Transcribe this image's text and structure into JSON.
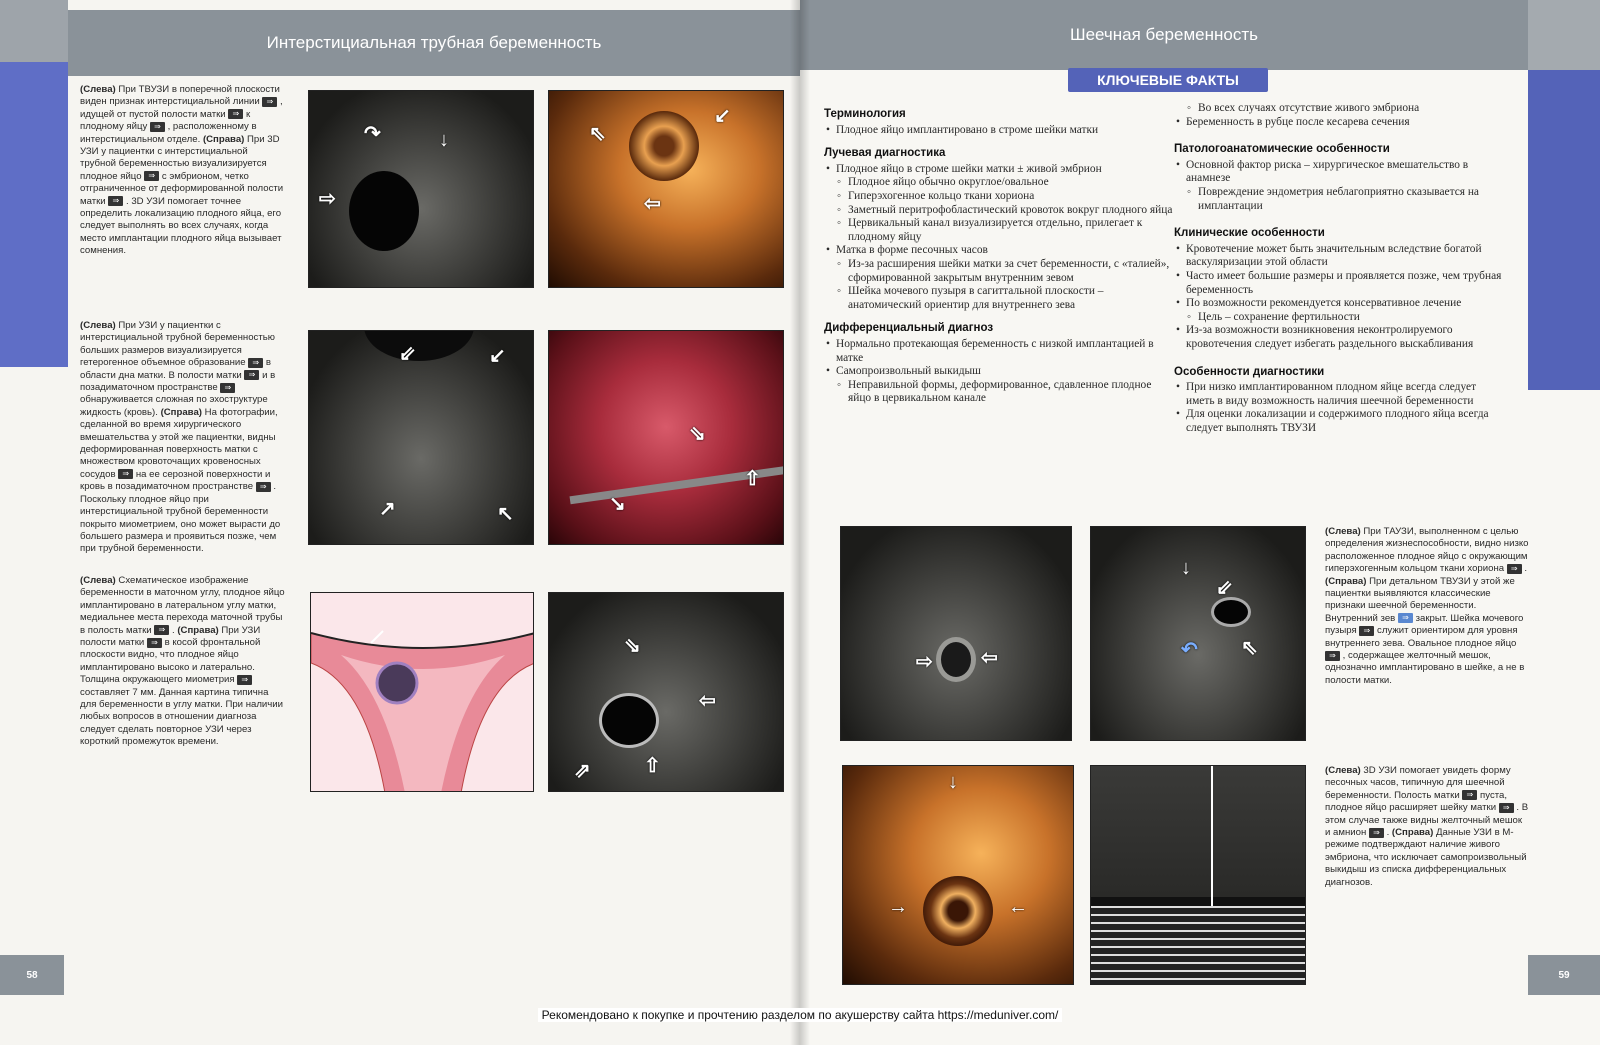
{
  "left_page": {
    "title": "Интерстициальная трубная беременность",
    "page_number": "58",
    "captions": [
      {
        "segments": [
          "(Слева)",
          " При ТВУЗИ в поперечной плоскости виден признак интерстициальной линии ",
          " , идущей от пустой полости матки ",
          " к плодному яйцу ",
          " , расположенному в интерстициальном отделе. ",
          "(Справа)",
          " При 3D УЗИ у пациентки с интерстициальной трубной беременностью визуализируется плодное яйцо ",
          " с эмбрионом, четко отграниченное от деформированной полости матки ",
          " . 3D УЗИ помогает точнее определить локализацию плодного яйца, его следует выполнять во всех случаях, когда место имплантации плодного яйца вызывает сомнения."
        ]
      },
      {
        "segments": [
          "(Слева)",
          " При УЗИ у пациентки с интерстициальной трубной беременностью больших размеров визуализируется гетерогенное объемное образование ",
          " в области дна матки. В полости матки ",
          " и в позадиматочном пространстве ",
          " обнаруживается сложная по эхоструктуре жидкость (кровь). ",
          "(Справа)",
          " На фотографии, сделанной во время хирургического вмешательства у этой же пациентки, видны деформированная поверхность матки с множеством кровоточащих кровеносных сосудов ",
          " на ее серозной поверхности и кровь в позадиматочном пространстве ",
          " . Поскольку плодное яйцо при интерстициальной трубной беременности покрыто миометрием, оно может вырасти до большего размера и проявиться позже, чем при трубной беременности."
        ]
      },
      {
        "segments": [
          "(Слева)",
          " Схематическое изображение беременности в маточном углу, плодное яйцо имплантировано в латеральном углу матки, медиальнее места перехода маточной трубы в полость матки ",
          " . ",
          "(Справа)",
          " При УЗИ полости матки ",
          " в косой фронтальной плоскости видно, что плодное яйцо имплантировано высоко и латерально. Толщина окружающего миометрия ",
          " составляет 7 мм. Данная картина типична для беременности в углу матки. При наличии любых вопросов в отношении диагноза следует сделать повторное УЗИ через короткий промежуток времени."
        ]
      }
    ]
  },
  "right_page": {
    "title": "Шеечная беременность",
    "page_number": "59",
    "facts_banner": "КЛЮЧЕВЫЕ ФАКТЫ",
    "col1": {
      "terminology": {
        "heading": "Терминология",
        "b1": "Плодное яйцо имплантировано в строме шейки матки"
      },
      "imaging": {
        "heading": "Лучевая диагностика",
        "b1": "Плодное яйцо в строме шейки матки ± живой эмбрион",
        "s1": "Плодное яйцо обычно округлое/овальное",
        "s2": "Гиперэхогенное кольцо ткани хориона",
        "s3": "Заметный перитрофобластический кровоток вокруг плодного яйца",
        "s4": "Цервикальный канал визуализируется отдельно, прилегает к плодному яйцу",
        "b2": "Матка в форме песочных часов",
        "s5": "Из-за расширения шейки матки за счет беременности, с «талией», сформированной закрытым внутренним зевом",
        "s6": "Шейка мочевого пузыря в сагиттальной плоскости – анатомический ориентир для внутреннего зева"
      },
      "diff": {
        "heading": "Дифференциальный диагноз",
        "b1": "Нормально протекающая беременность с низкой имплантацией в матке",
        "b2": "Самопроизвольный выкидыш",
        "s1": "Неправильной формы, деформированное, сдавленное плодное яйцо в цервикальном канале"
      }
    },
    "col2": {
      "top": {
        "s1": "Во всех случаях отсутствие живого эмбриона",
        "b1": "Беременность в рубце после кесарева сечения"
      },
      "patho": {
        "heading": "Патологоанатомические особенности",
        "b1": "Основной фактор риска – хирургическое вмешательство в анамнезе",
        "s1": "Повреждение эндометрия неблагоприятно сказывается на имплантации"
      },
      "clinic": {
        "heading": "Клинические особенности",
        "b1": "Кровотечение может быть значительным вследствие богатой васкуляризации этой области",
        "b2": "Часто имеет большие размеры и проявляется позже, чем трубная беременность",
        "b3": "По возможности рекомендуется консервативное лечение",
        "s1": "Цель – сохранение фертильности",
        "b4": "Из-за возможности возникновения неконтролируемого кровотечения следует избегать раздельного выскабливания"
      },
      "diag": {
        "heading": "Особенности диагностики",
        "b1": "При низко имплантированном плодном яйце всегда следует иметь в виду возможность наличия шеечной беременности",
        "b2": "Для оценки локализации и содержимого плодного яйца всегда следует выполнять ТВУЗИ"
      }
    },
    "captions": [
      {
        "segments": [
          "(Слева)",
          " При ТАУЗИ, выполненном с целью определения жизнеспособности, видно низко расположенное плодное яйцо с окружающим гиперэхогенным кольцом ткани хориона ",
          " . ",
          "(Справа)",
          " При детальном ТВУЗИ у этой же пациентки выявляются классические признаки шеечной беременности. Внутренний зев ",
          " закрыт. Шейка мочевого пузыря ",
          " служит ориентиром для уровня внутреннего зева. Овальное плодное яйцо ",
          " , содержащее желточный мешок, однозначно имплантировано в шейке, а не в полости матки."
        ]
      },
      {
        "segments": [
          "(Слева)",
          " 3D УЗИ помогает увидеть форму песочных часов, типичную для шеечной беременности. Полость матки ",
          " пуста, плодное яйцо расширяет шейку матки ",
          " . В этом случае также видны желточный мешок и амнион ",
          " . ",
          "(Справа)",
          " Данные УЗИ в М-режиме подтверждают наличие живого эмбриона, что исключает самопроизвольный выкидыш из списка дифференциальных диагнозов."
        ]
      }
    ]
  },
  "footer": "Рекомендовано к покупке и прочтению разделом по акушерству сайта https://meduniver.com/",
  "colors": {
    "accent_blue": "#5463b8",
    "header_grey": "#8a9299"
  }
}
